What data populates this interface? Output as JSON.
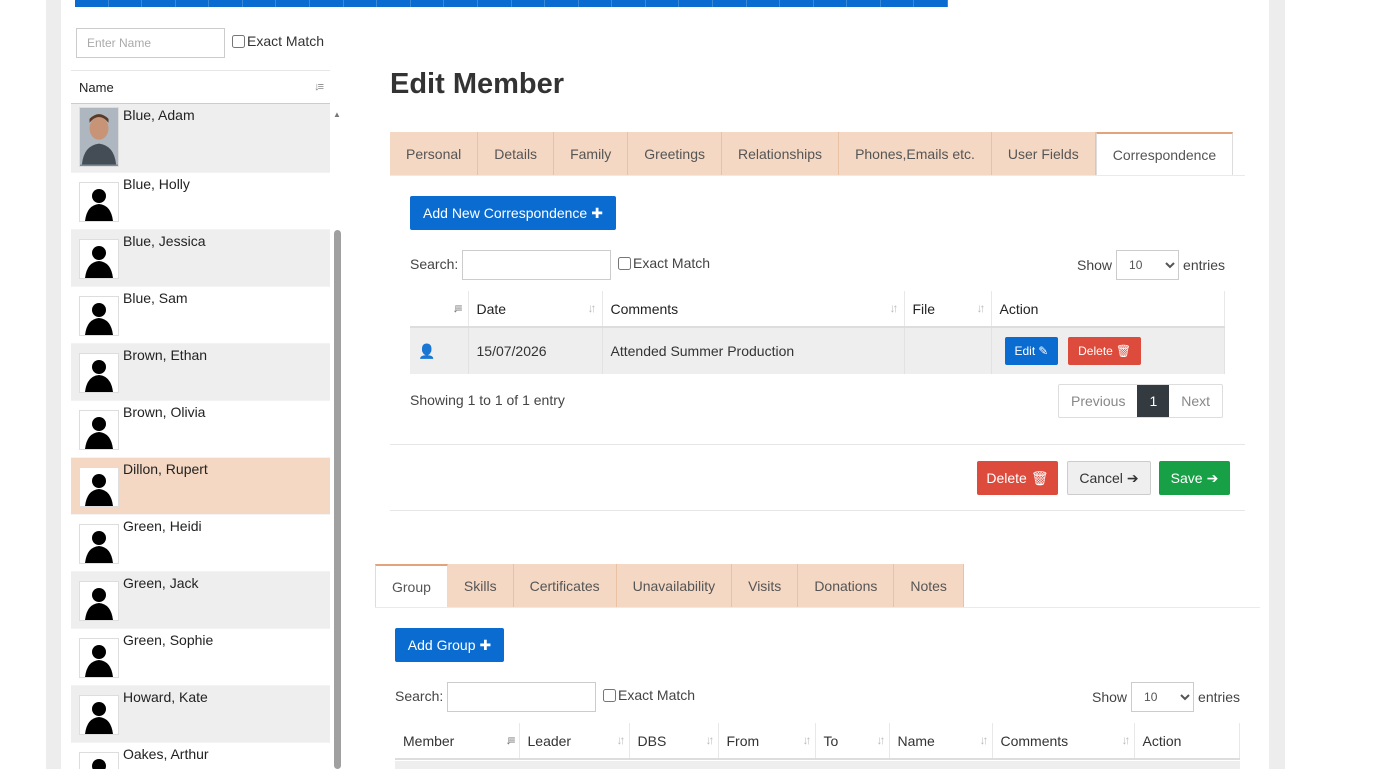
{
  "left": {
    "search_placeholder": "Enter Name",
    "exact_match": "Exact Match",
    "name_header": "Name",
    "members": [
      "Blue, Adam",
      "Blue, Holly",
      "Blue, Jessica",
      "Blue, Sam",
      "Brown, Ethan",
      "Brown, Olivia",
      "Dillon, Rupert",
      "Green, Heidi",
      "Green, Jack",
      "Green, Sophie",
      "Howard, Kate",
      "Oakes, Arthur"
    ],
    "selected": "Dillon, Rupert"
  },
  "main": {
    "title": "Edit Member",
    "tabs": [
      "Personal",
      "Details",
      "Family",
      "Greetings",
      "Relationships",
      "Phones,Emails etc.",
      "User Fields",
      "Correspondence"
    ],
    "active_tab": "Correspondence",
    "add_button": "Add New Correspondence",
    "search_label": "Search:",
    "exact_match": "Exact Match",
    "show_label": "Show",
    "show_value": "10",
    "entries_label": "entries",
    "table": {
      "columns": [
        "",
        "Date",
        "Comments",
        "File",
        "Action"
      ],
      "rows": [
        {
          "date": "15/07/2026",
          "comments": "Attended Summer Production",
          "file": ""
        }
      ],
      "edit_label": "Edit",
      "delete_label": "Delete"
    },
    "showing": "Showing 1 to 1 of 1 entry",
    "pager": {
      "previous": "Previous",
      "page": "1",
      "next": "Next"
    },
    "buttons": {
      "delete": "Delete",
      "cancel": "Cancel",
      "save": "Save"
    }
  },
  "group_section": {
    "tabs": [
      "Group",
      "Skills",
      "Certificates",
      "Unavailability",
      "Visits",
      "Donations",
      "Notes"
    ],
    "active_tab": "Group",
    "add_button": "Add Group",
    "search_label": "Search:",
    "exact_match": "Exact Match",
    "show_label": "Show",
    "show_value": "10",
    "entries_label": "entries",
    "columns": [
      "Member",
      "Leader",
      "DBS",
      "From",
      "To",
      "Name",
      "Comments",
      "Action"
    ]
  },
  "colors": {
    "primary": "#0a6cd1",
    "danger": "#dc4b3c",
    "success": "#18a046",
    "tab": "#f5d8c3"
  }
}
